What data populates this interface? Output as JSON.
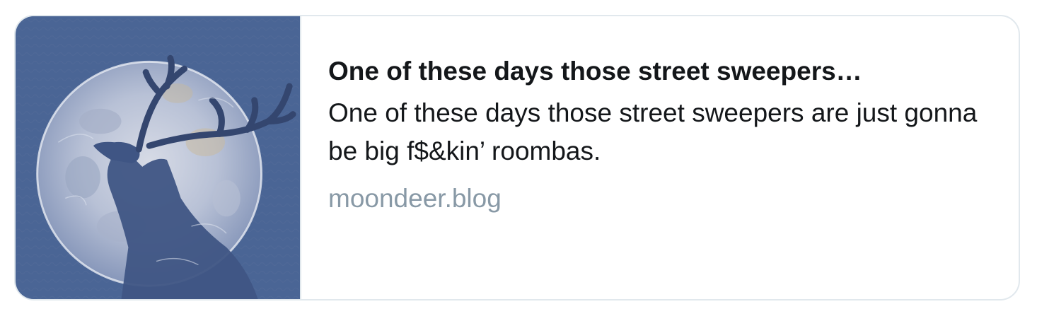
{
  "card": {
    "title": "One of these days those street sweepers…",
    "description": "One of these days those street sweepers are just gonna be big f$&kin’ roombas.",
    "domain": "moondeer.blog",
    "thumbnail_icon": "moon-deer-illustration"
  },
  "colors": {
    "border": "#e1e8ed",
    "title": "#14171a",
    "domain": "#8899a6",
    "thumbnail_bg": "#4a6595"
  }
}
